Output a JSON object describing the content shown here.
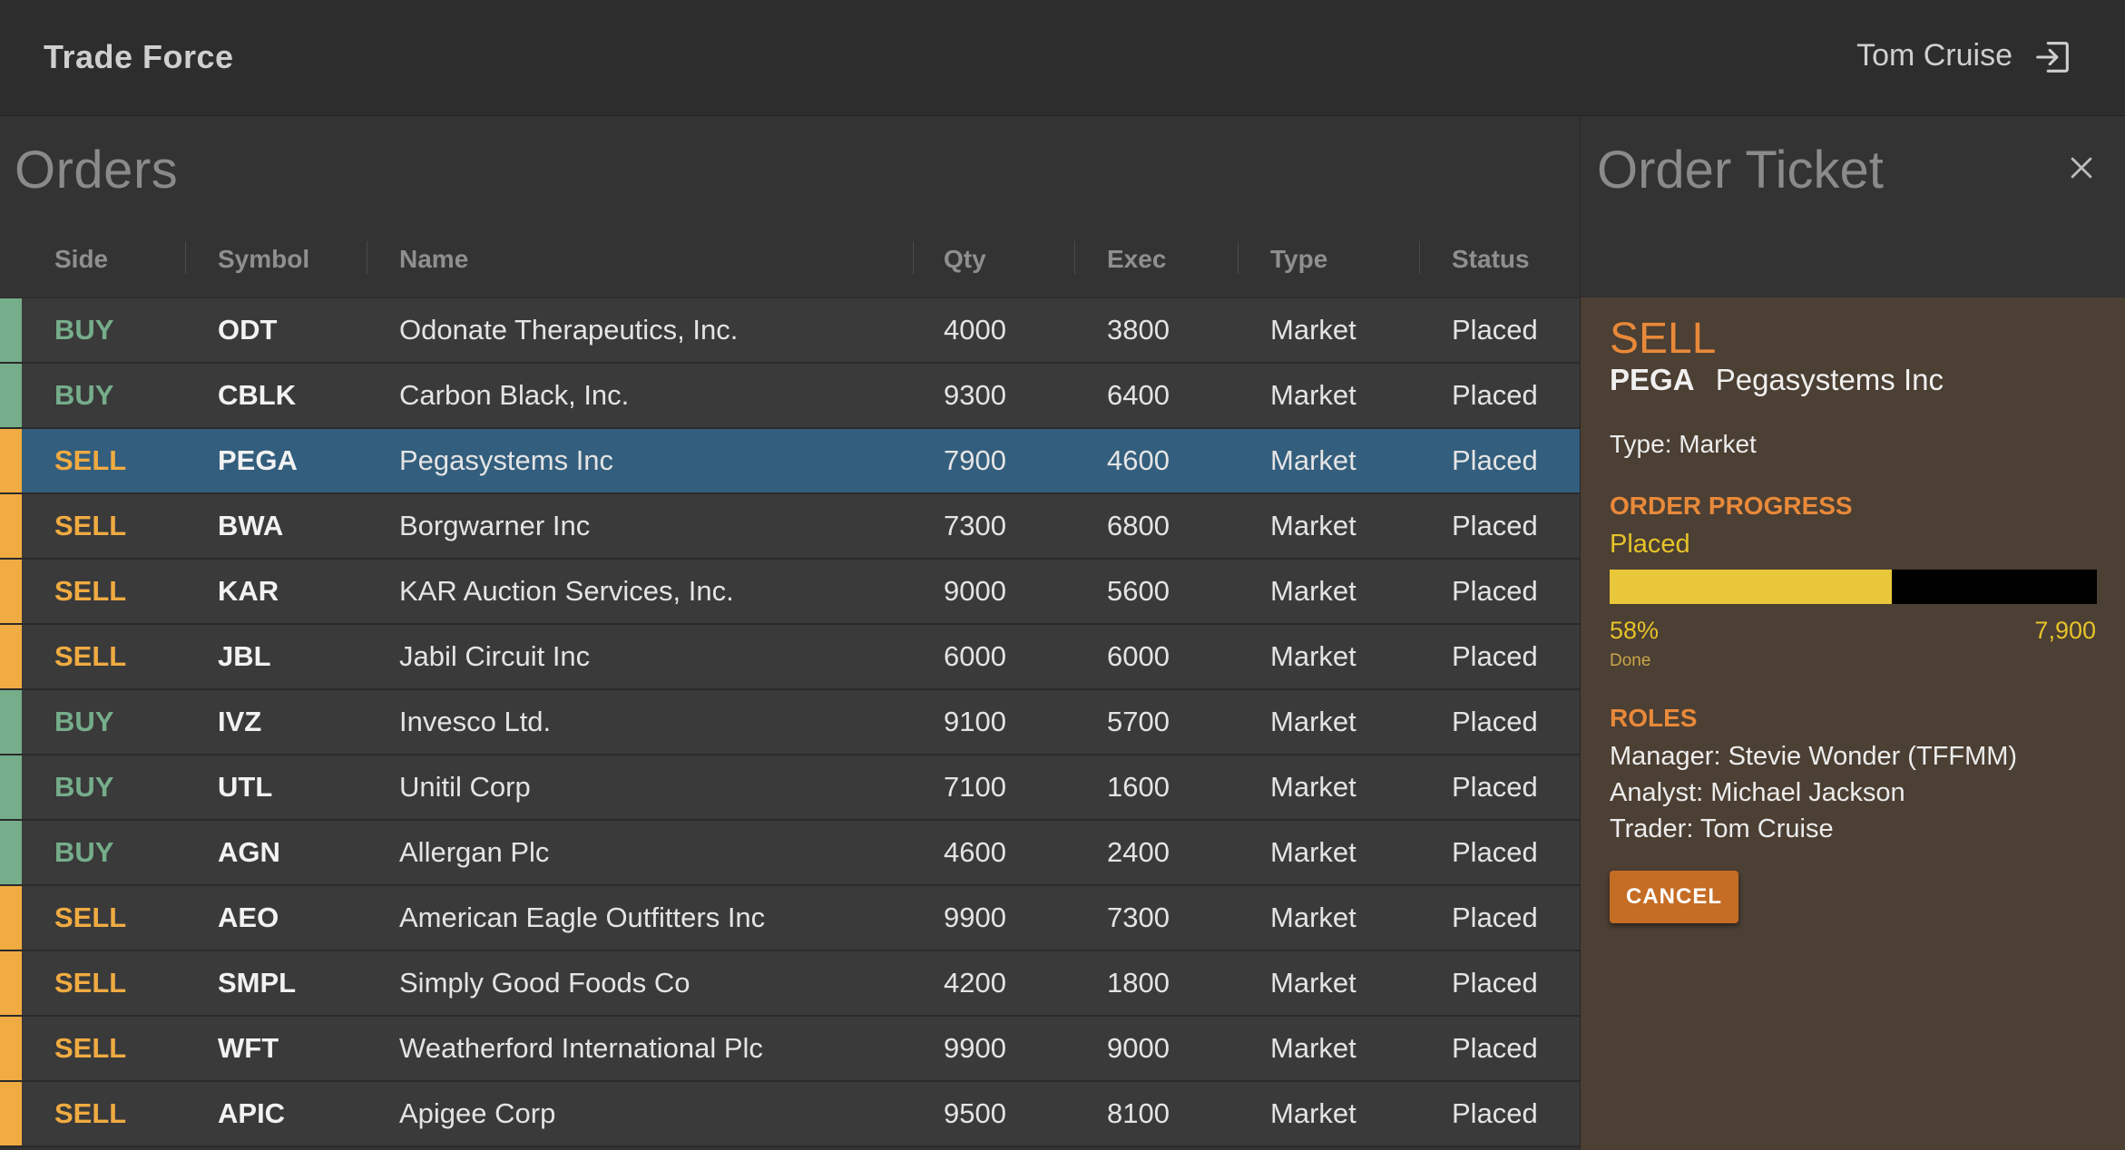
{
  "app": {
    "title": "Trade Force",
    "user": "Tom Cruise",
    "logout_icon": "logout-icon"
  },
  "orders": {
    "title": "Orders",
    "columns": [
      "Side",
      "Symbol",
      "Name",
      "Qty",
      "Exec",
      "Type",
      "Status"
    ],
    "rows": [
      {
        "side": "BUY",
        "symbol": "ODT",
        "name": "Odonate Therapeutics, Inc.",
        "qty": "4000",
        "exec": "3800",
        "type": "Market",
        "status": "Placed",
        "selected": false
      },
      {
        "side": "BUY",
        "symbol": "CBLK",
        "name": "Carbon Black, Inc.",
        "qty": "9300",
        "exec": "6400",
        "type": "Market",
        "status": "Placed",
        "selected": false
      },
      {
        "side": "SELL",
        "symbol": "PEGA",
        "name": "Pegasystems Inc",
        "qty": "7900",
        "exec": "4600",
        "type": "Market",
        "status": "Placed",
        "selected": true
      },
      {
        "side": "SELL",
        "symbol": "BWA",
        "name": "Borgwarner Inc",
        "qty": "7300",
        "exec": "6800",
        "type": "Market",
        "status": "Placed",
        "selected": false
      },
      {
        "side": "SELL",
        "symbol": "KAR",
        "name": "KAR Auction Services, Inc.",
        "qty": "9000",
        "exec": "5600",
        "type": "Market",
        "status": "Placed",
        "selected": false
      },
      {
        "side": "SELL",
        "symbol": "JBL",
        "name": "Jabil Circuit Inc",
        "qty": "6000",
        "exec": "6000",
        "type": "Market",
        "status": "Placed",
        "selected": false
      },
      {
        "side": "BUY",
        "symbol": "IVZ",
        "name": "Invesco Ltd.",
        "qty": "9100",
        "exec": "5700",
        "type": "Market",
        "status": "Placed",
        "selected": false
      },
      {
        "side": "BUY",
        "symbol": "UTL",
        "name": "Unitil Corp",
        "qty": "7100",
        "exec": "1600",
        "type": "Market",
        "status": "Placed",
        "selected": false
      },
      {
        "side": "BUY",
        "symbol": "AGN",
        "name": "Allergan Plc",
        "qty": "4600",
        "exec": "2400",
        "type": "Market",
        "status": "Placed",
        "selected": false
      },
      {
        "side": "SELL",
        "symbol": "AEO",
        "name": "American Eagle Outfitters Inc",
        "qty": "9900",
        "exec": "7300",
        "type": "Market",
        "status": "Placed",
        "selected": false
      },
      {
        "side": "SELL",
        "symbol": "SMPL",
        "name": "Simply Good Foods Co",
        "qty": "4200",
        "exec": "1800",
        "type": "Market",
        "status": "Placed",
        "selected": false
      },
      {
        "side": "SELL",
        "symbol": "WFT",
        "name": "Weatherford International Plc",
        "qty": "9900",
        "exec": "9000",
        "type": "Market",
        "status": "Placed",
        "selected": false
      },
      {
        "side": "SELL",
        "symbol": "APIC",
        "name": "Apigee Corp",
        "qty": "9500",
        "exec": "8100",
        "type": "Market",
        "status": "Placed",
        "selected": false
      }
    ]
  },
  "ticket": {
    "title": "Order Ticket",
    "close_icon": "close-icon",
    "side": "SELL",
    "symbol": "PEGA",
    "name": "Pegasystems Inc",
    "type_line": "Type: Market",
    "progress_heading": "ORDER PROGRESS",
    "progress_status": "Placed",
    "progress_fraction": 0.58,
    "progress_percent_label": "58%",
    "progress_total_label": "7,900",
    "progress_done_label": "Done",
    "roles_heading": "ROLES",
    "roles": [
      "Manager: Stevie Wonder (TFFMM)",
      "Analyst: Michael Jackson",
      "Trader: Tom Cruise"
    ],
    "cancel_label": "CANCEL"
  },
  "colors": {
    "buy": "#76ad8b",
    "sell": "#f0ab42",
    "selected_row": "#335e7d",
    "ticket_bg": "#4c3f33",
    "ticket_accent": "#e8893a",
    "progress_fill": "#e8c73a",
    "cancel_button": "#c56c25"
  }
}
